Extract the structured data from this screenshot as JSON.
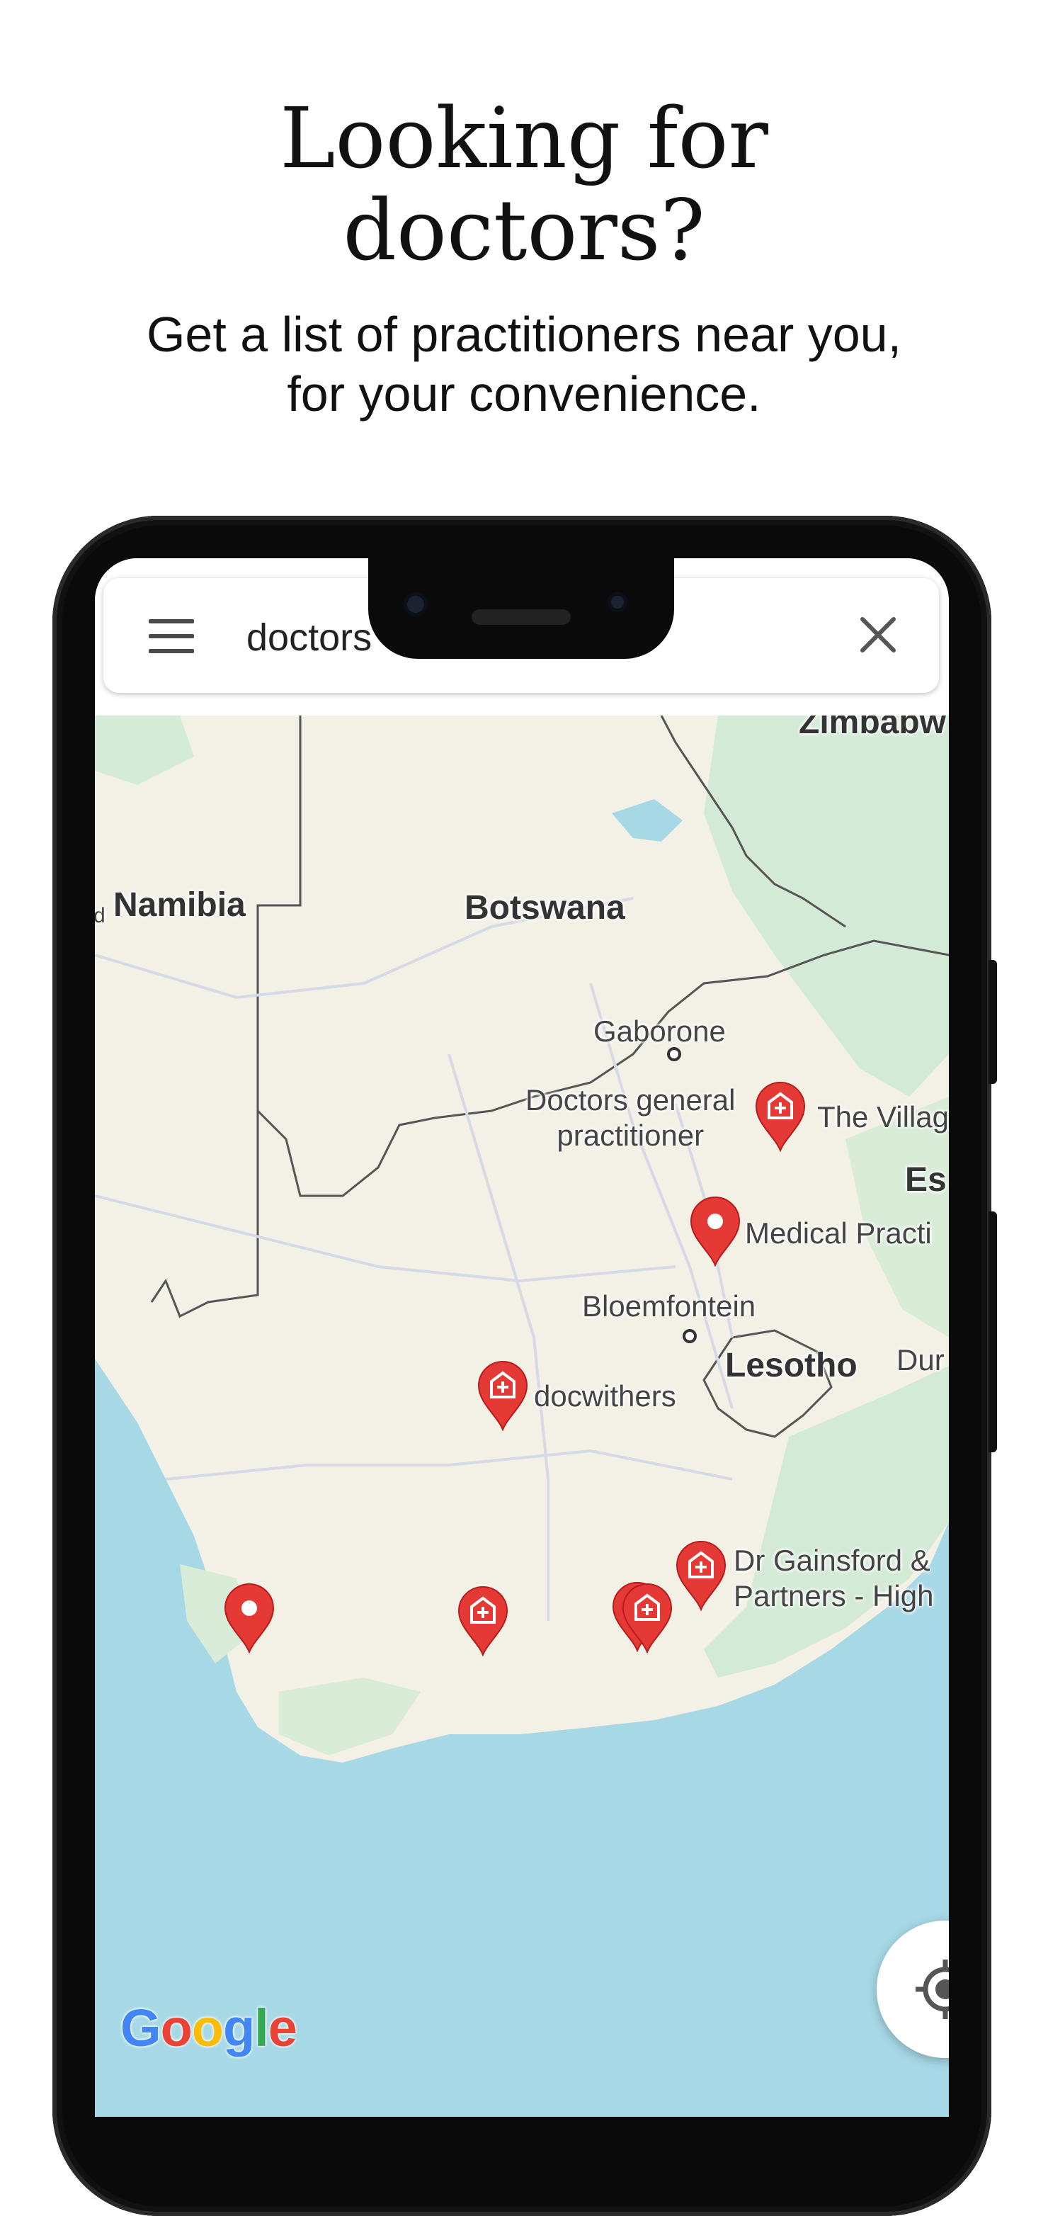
{
  "hero": {
    "title_line1": "Looking for",
    "title_line2": "doctors?",
    "subtitle_line1": "Get a list of practitioners near you,",
    "subtitle_line2": "for your convenience."
  },
  "search": {
    "query": "doctors",
    "menu_icon": "hamburger-menu-icon",
    "clear_icon": "close-icon"
  },
  "map": {
    "countries": [
      "Namibia",
      "Botswana",
      "Lesotho",
      "Zimbabw",
      "Es"
    ],
    "namibia_prefix": "d",
    "cities": [
      "Gaborone",
      "Bloemfontein",
      "Dur"
    ],
    "places": {
      "doctors_gp_line1": "Doctors general",
      "doctors_gp_line2": "practitioner",
      "the_village": "The Villag",
      "medical_practice": "Medical Practi",
      "docwithers": "docwithers",
      "gainsford_line1": "Dr Gainsford &",
      "gainsford_line2": "Partners - High"
    },
    "marker_color": "#E53935",
    "water_color": "#A7D8E6",
    "land_color": "#F3F0E6",
    "attribution": [
      "G",
      "o",
      "o",
      "g",
      "l",
      "e"
    ]
  },
  "controls": {
    "locate_icon": "my-location-icon"
  }
}
